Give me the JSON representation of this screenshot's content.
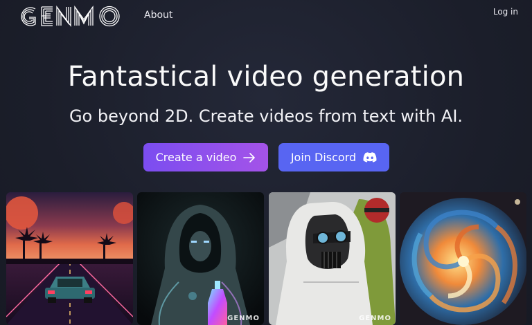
{
  "brand": {
    "name": "GENMO"
  },
  "nav": {
    "about": "About",
    "login": "Log in"
  },
  "hero": {
    "title": "Fantastical video generation",
    "subtitle": "Go beyond 2D. Create videos from text with AI."
  },
  "cta": {
    "create_label": "Create a video",
    "create_icon": "arrow-right-icon",
    "discord_label": "Join Discord",
    "discord_icon": "discord-icon"
  },
  "gallery": {
    "watermark": "GENMO",
    "items": [
      {
        "subject": "synthwave-car-sunset"
      },
      {
        "subject": "hooded-figure-potion"
      },
      {
        "subject": "masked-hoodie-figures"
      },
      {
        "subject": "cosmic-swirl"
      }
    ]
  },
  "colors": {
    "background": "#1b1e2a",
    "create_gradient_start": "#7b4df0",
    "create_gradient_end": "#a453e8",
    "discord": "#5865f2"
  }
}
